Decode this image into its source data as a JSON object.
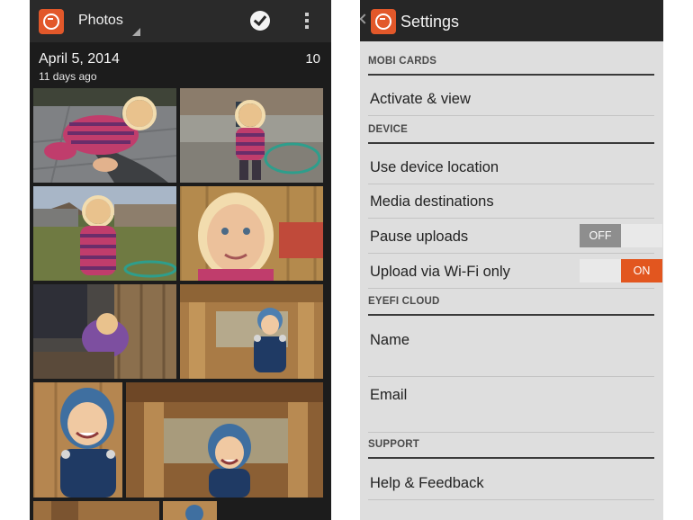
{
  "photos_screen": {
    "title": "Photos",
    "date": "April 5, 2014",
    "subtitle": "11 days ago",
    "count": "10"
  },
  "settings_screen": {
    "title": "Settings",
    "sections": [
      {
        "header": "MOBI CARDS",
        "items": [
          {
            "label": "Activate & view"
          }
        ]
      },
      {
        "header": "DEVICE",
        "items": [
          {
            "label": "Use device location"
          },
          {
            "label": "Media destinations"
          },
          {
            "label": "Pause uploads",
            "toggle": "OFF"
          },
          {
            "label": "Upload via Wi-Fi only",
            "toggle": "ON"
          }
        ]
      },
      {
        "header": "EYEFI CLOUD",
        "items": [
          {
            "label": "Name"
          },
          {
            "label": "Email"
          }
        ]
      },
      {
        "header": "SUPPORT",
        "items": [
          {
            "label": "Help & Feedback"
          }
        ]
      }
    ]
  },
  "colors": {
    "brand_orange": "#e2582a",
    "toggle_on": "#e2561f",
    "toggle_off": "#8e8e8e",
    "settings_bg": "#dedede",
    "photos_bg": "#1c1c1c"
  }
}
